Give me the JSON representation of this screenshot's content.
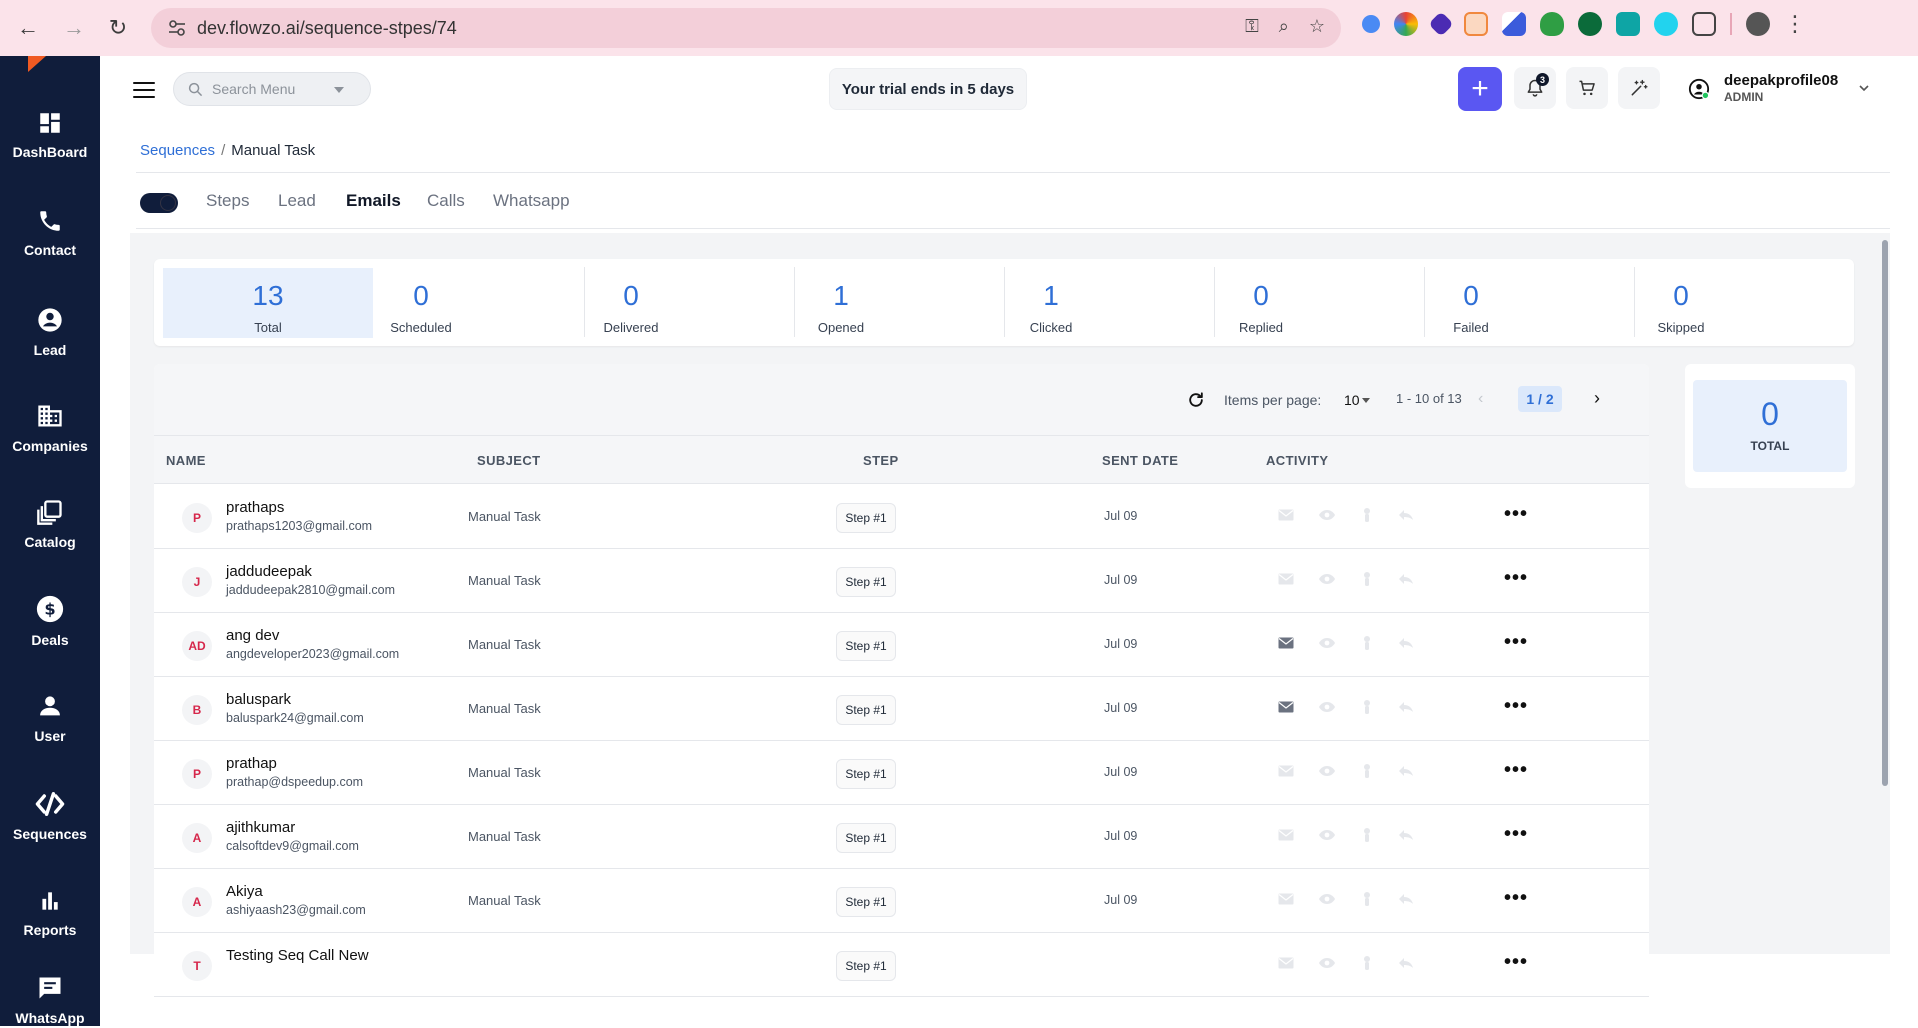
{
  "browser": {
    "url": "dev.flowzo.ai/sequence-stpes/74"
  },
  "sidebar": {
    "items": [
      {
        "label": "DashBoard",
        "icon": "dashboard-icon"
      },
      {
        "label": "Contact",
        "icon": "phone-icon"
      },
      {
        "label": "Lead",
        "icon": "person-circle-icon"
      },
      {
        "label": "Companies",
        "icon": "building-icon"
      },
      {
        "label": "Catalog",
        "icon": "catalog-icon"
      },
      {
        "label": "Deals",
        "icon": "dollar-icon"
      },
      {
        "label": "User",
        "icon": "user-icon"
      },
      {
        "label": "Sequences",
        "icon": "sequences-icon"
      },
      {
        "label": "Reports",
        "icon": "bar-chart-icon"
      },
      {
        "label": "WhatsApp",
        "icon": "chat-icon"
      }
    ]
  },
  "header": {
    "search_placeholder": "Search Menu",
    "trial_text": "Your trial ends in 5 days",
    "notification_count": "3",
    "profile_name": "deepakprofile08",
    "profile_role": "ADMIN"
  },
  "breadcrumb": {
    "parent": "Sequences",
    "separator": "/",
    "current": "Manual Task"
  },
  "tabs": [
    "Steps",
    "Lead",
    "Emails",
    "Calls",
    "Whatsapp"
  ],
  "active_tab": "Emails",
  "stats": [
    {
      "value": "13",
      "label": "Total"
    },
    {
      "value": "0",
      "label": "Scheduled"
    },
    {
      "value": "0",
      "label": "Delivered"
    },
    {
      "value": "1",
      "label": "Opened"
    },
    {
      "value": "1",
      "label": "Clicked"
    },
    {
      "value": "0",
      "label": "Replied"
    },
    {
      "value": "0",
      "label": "Failed"
    },
    {
      "value": "0",
      "label": "Skipped"
    }
  ],
  "pager": {
    "items_per_page_label": "Items per page:",
    "items_per_page": "10",
    "range": "1 - 10 of 13",
    "page": "1 / 2"
  },
  "table": {
    "columns": [
      "NAME",
      "SUBJECT",
      "STEP",
      "SENT DATE",
      "ACTIVITY"
    ],
    "rows": [
      {
        "initials": "P",
        "name": "prathaps",
        "email": "prathaps1203@gmail.com",
        "subject": "Manual Task",
        "step": "Step #1",
        "date": "Jul 09",
        "sent": false
      },
      {
        "initials": "J",
        "name": "jaddudeepak",
        "email": "jaddudeepak2810@gmail.com",
        "subject": "Manual Task",
        "step": "Step #1",
        "date": "Jul 09",
        "sent": false
      },
      {
        "initials": "AD",
        "name": "ang dev",
        "email": "angdeveloper2023@gmail.com",
        "subject": "Manual Task",
        "step": "Step #1",
        "date": "Jul 09",
        "sent": true
      },
      {
        "initials": "B",
        "name": "baluspark",
        "email": "baluspark24@gmail.com",
        "subject": "Manual Task",
        "step": "Step #1",
        "date": "Jul 09",
        "sent": true
      },
      {
        "initials": "P",
        "name": "prathap",
        "email": "prathap@dspeedup.com",
        "subject": "Manual Task",
        "step": "Step #1",
        "date": "Jul 09",
        "sent": false
      },
      {
        "initials": "A",
        "name": "ajithkumar",
        "email": "calsoftdev9@gmail.com",
        "subject": "Manual Task",
        "step": "Step #1",
        "date": "Jul 09",
        "sent": false
      },
      {
        "initials": "A",
        "name": "Akiya",
        "email": "ashiyaash23@gmail.com",
        "subject": "Manual Task",
        "step": "Step #1",
        "date": "Jul 09",
        "sent": false
      },
      {
        "initials": "T",
        "name": "Testing Seq Call New",
        "email": "",
        "subject": "",
        "step": "Step #1",
        "date": "",
        "sent": false
      }
    ]
  },
  "side_card": {
    "value": "0",
    "label": "TOTAL"
  },
  "colors": {
    "sidebar_bg": "#101d3b",
    "accent_blue": "#2f6fd6",
    "plus_button": "#5a57f2",
    "avatar_text": "#d6274b"
  }
}
